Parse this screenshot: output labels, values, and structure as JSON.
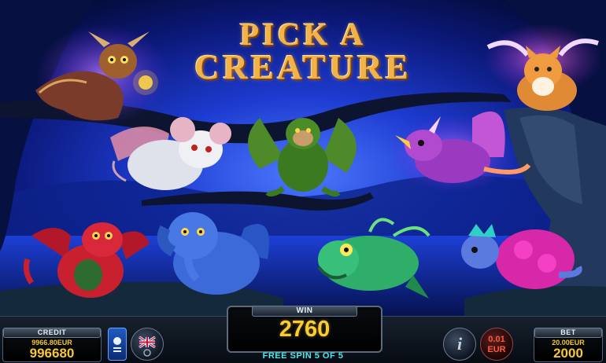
{
  "title": {
    "line1": "PICK A",
    "line2": "CREATURE"
  },
  "creatures": [
    {
      "id": "owl",
      "name": "owl-creature"
    },
    {
      "id": "fox",
      "name": "winged-fox-creature"
    },
    {
      "id": "mouse",
      "name": "winged-mouse-creature"
    },
    {
      "id": "monkey",
      "name": "winged-monkey-creature"
    },
    {
      "id": "bird",
      "name": "unicorn-bird-creature"
    },
    {
      "id": "dragon",
      "name": "red-dragon-creature"
    },
    {
      "id": "elephant",
      "name": "blue-elephant-creature"
    },
    {
      "id": "fish",
      "name": "green-fish-creature"
    },
    {
      "id": "turtle",
      "name": "pink-turtle-creature"
    }
  ],
  "bottom_bar": {
    "credit": {
      "label": "CREDIT",
      "amount": "9966.80EUR",
      "value": "996680"
    },
    "win": {
      "label": "WIN",
      "value": "2760"
    },
    "free_spins": "FREE SPIN 5 OF 5",
    "bet": {
      "label": "BET",
      "amount": "20.00EUR",
      "value": "2000"
    },
    "denomination": {
      "value": "0.01",
      "currency": "EUR"
    },
    "info_label": "i"
  },
  "colors": {
    "title_gold": "#f1b24a",
    "value_yellow": "#f7c735",
    "freespin_cyan": "#49e9ef",
    "night_blue": "#0a1a6a"
  }
}
